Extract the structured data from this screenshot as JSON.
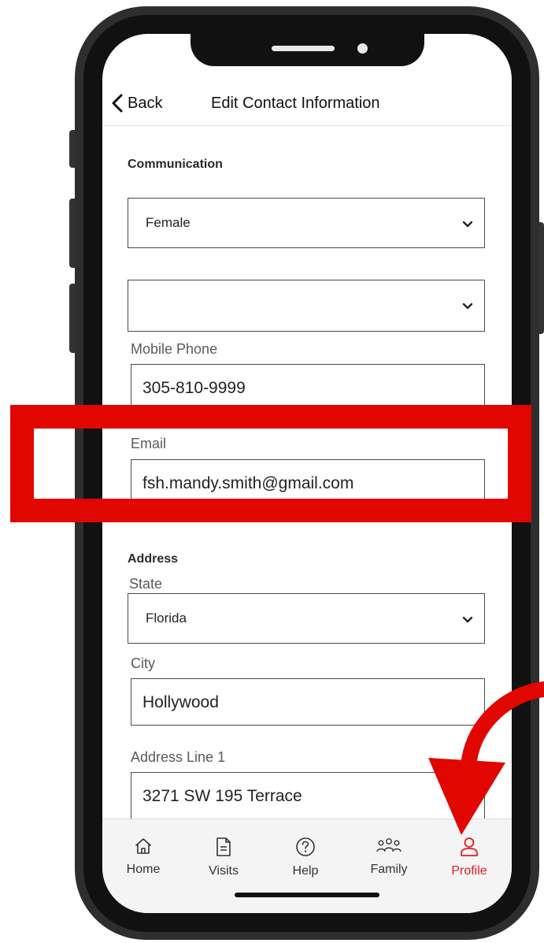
{
  "header": {
    "back_label": "Back",
    "title": "Edit Contact Information"
  },
  "communication": {
    "section_title": "Communication",
    "gender_select": {
      "value": "Female"
    },
    "second_select": {
      "value": ""
    },
    "mobile_phone": {
      "label": "Mobile Phone",
      "value": "305-810-9999"
    },
    "email": {
      "label": "Email",
      "value": "fsh.mandy.smith@gmail.com"
    }
  },
  "address": {
    "section_title": "Address",
    "state": {
      "label": "State",
      "value": "Florida"
    },
    "city": {
      "label": "City",
      "value": "Hollywood"
    },
    "address_line_1": {
      "label": "Address Line 1",
      "value": "3271 SW 195 Terrace"
    }
  },
  "tab_bar": {
    "items": [
      {
        "label": "Home",
        "icon": "home-icon"
      },
      {
        "label": "Visits",
        "icon": "document-icon"
      },
      {
        "label": "Help",
        "icon": "help-icon"
      },
      {
        "label": "Family",
        "icon": "family-icon"
      },
      {
        "label": "Profile",
        "icon": "profile-icon"
      }
    ],
    "active": "Profile"
  },
  "colors": {
    "accent": "#e31b23",
    "highlight": "#e10600",
    "phone_frame": "#2e2e2e",
    "text_primary": "#222222"
  }
}
